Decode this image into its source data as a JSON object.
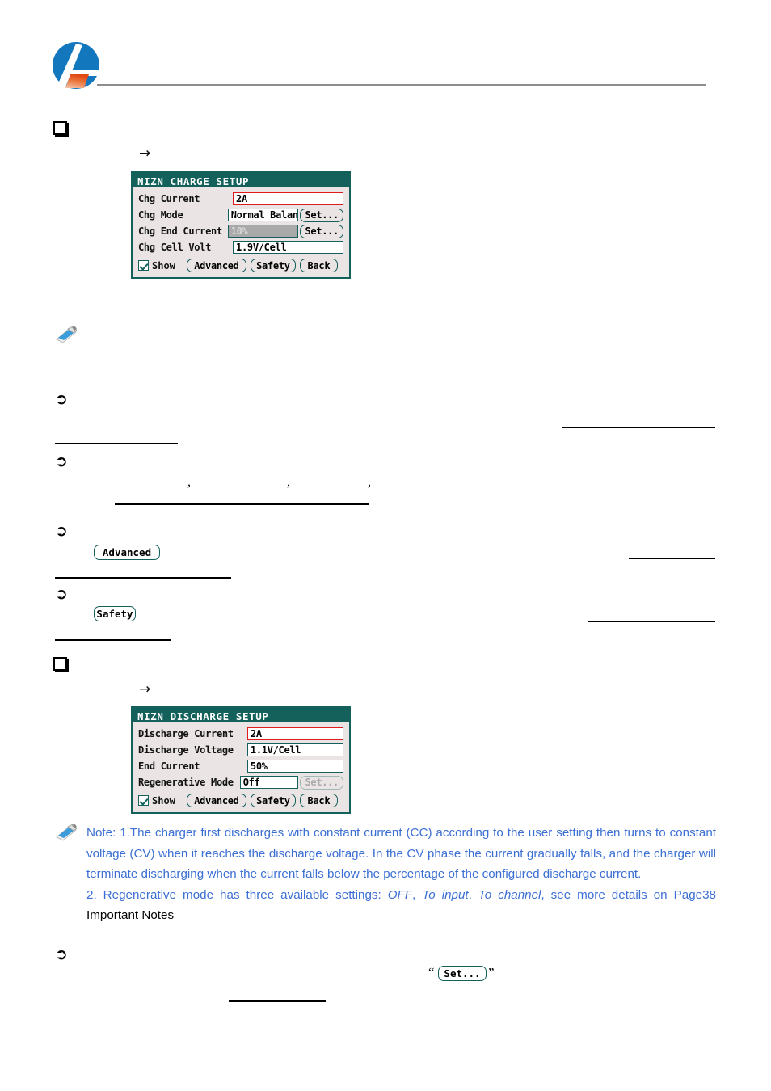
{
  "header": {
    "logo_alt": "company-logo",
    "logo_colors": {
      "blue": "#1277bd",
      "orange": "#e8642a",
      "rule": "#8d8d8d"
    }
  },
  "charge_screen": {
    "title": "NIZN CHARGE SETUP",
    "rows": [
      {
        "label": "Chg Current",
        "value": "2A",
        "state": "focus",
        "button": null
      },
      {
        "label": "Chg Mode",
        "value": "Normal Balance",
        "state": "normal",
        "button": "Set..."
      },
      {
        "label": "Chg End Current",
        "value": "10%",
        "state": "disabled",
        "button": "Set..."
      },
      {
        "label": "Chg Cell Volt",
        "value": "1.9V/Cell",
        "state": "normal",
        "button": null
      }
    ],
    "footer": {
      "checkbox_label": "Show",
      "checkbox_checked": true,
      "buttons": [
        "Advanced",
        "Safety",
        "Back"
      ]
    }
  },
  "discharge_screen": {
    "title": "NIZN DISCHARGE SETUP",
    "rows": [
      {
        "label": "Discharge Current",
        "value": "2A",
        "state": "focus",
        "button": null
      },
      {
        "label": "Discharge Voltage",
        "value": "1.1V/Cell",
        "state": "normal",
        "button": null
      },
      {
        "label": "End Current",
        "value": "50%",
        "state": "normal",
        "button": null
      },
      {
        "label": "Regenerative Mode",
        "value": "Off",
        "state": "normal",
        "button": "Set...",
        "button_state": "disabled"
      }
    ],
    "footer": {
      "checkbox_label": "Show",
      "checkbox_checked": true,
      "buttons": [
        "Advanced",
        "Safety",
        "Back"
      ]
    }
  },
  "inline_buttons": {
    "advanced": "Advanced",
    "safety": "Safety",
    "set": "Set...",
    "quote_open": "“",
    "quote_close": "”"
  },
  "glyphs": {
    "arrow": "→",
    "bullet_arrow": "➲",
    "comma": ","
  },
  "note": {
    "icon": "note-pencil-icon",
    "text_color": "#3b6fd4",
    "item1_lead": "Note: 1.The charger first discharges with constant current (CC) according to the user setting then turns to constant voltage (CV) when it reaches the discharge voltage. In the CV phase the current gradually falls, and the charger will terminate discharging when the current falls below the percentage of the configured discharge current.",
    "item2_pre": "2. Regenerative mode has three available settings: ",
    "item2_opt1": "OFF",
    "item2_sep1": ", ",
    "item2_opt2": "To input",
    "item2_sep2": ", ",
    "item2_opt3": "To channel",
    "item2_post": ", see more details on ",
    "item2_page": "Page38",
    "item2_space": " ",
    "item2_link": "Important Notes"
  }
}
